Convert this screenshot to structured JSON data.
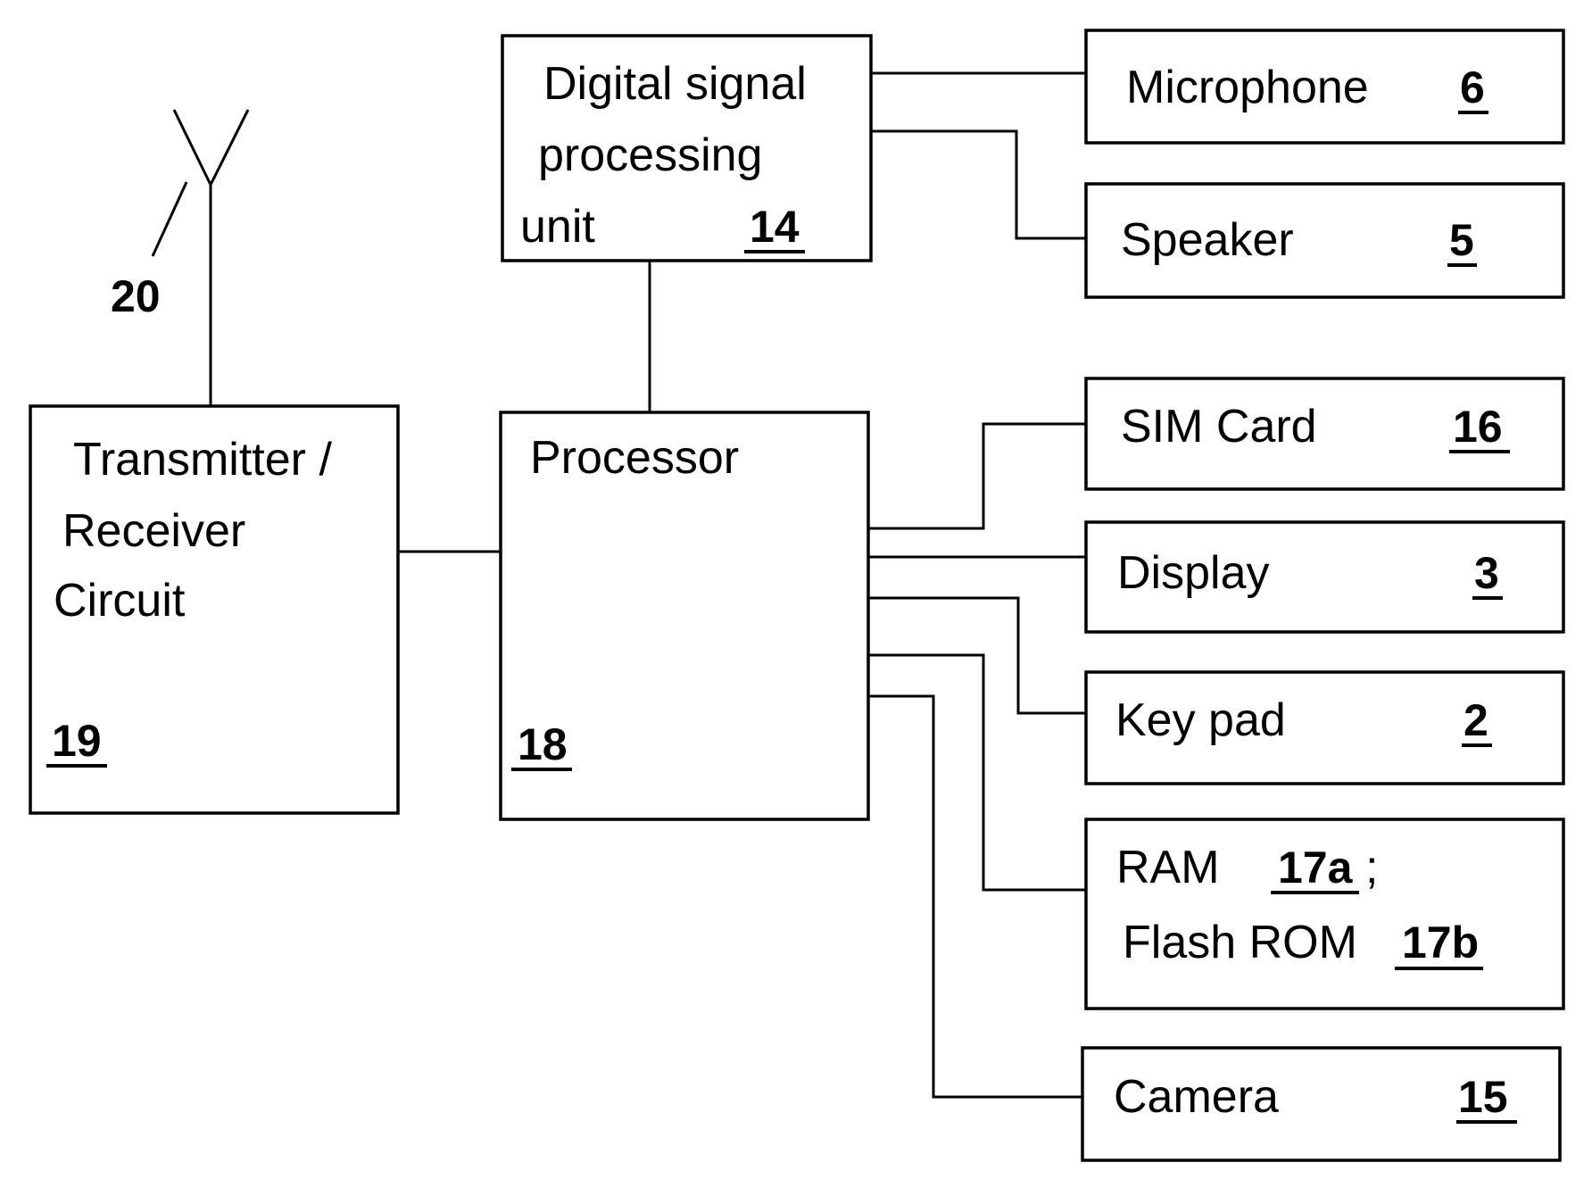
{
  "figure": {
    "antenna": {
      "ref": "20"
    },
    "blocks": {
      "transmitter": {
        "lines": [
          "Transmitter /",
          "Receiver",
          "Circuit"
        ],
        "ref": "19"
      },
      "processor": {
        "lines": [
          "Processor"
        ],
        "ref": "18"
      },
      "dsp": {
        "lines": [
          "Digital signal",
          "processing",
          "unit"
        ],
        "ref": "14"
      },
      "microphone": {
        "label": "Microphone",
        "ref": "6"
      },
      "speaker": {
        "label": "Speaker",
        "ref": "5"
      },
      "sim": {
        "label": "SIM Card",
        "ref": "16"
      },
      "display": {
        "label": "Display",
        "ref": "3"
      },
      "keypad": {
        "label": "Key pad",
        "ref": "2"
      },
      "memory": {
        "ram_label": "RAM",
        "ram_ref": "17a",
        "separator": ";",
        "rom_label": "Flash ROM",
        "rom_ref": "17b"
      },
      "camera": {
        "label": "Camera",
        "ref": "15"
      }
    }
  }
}
